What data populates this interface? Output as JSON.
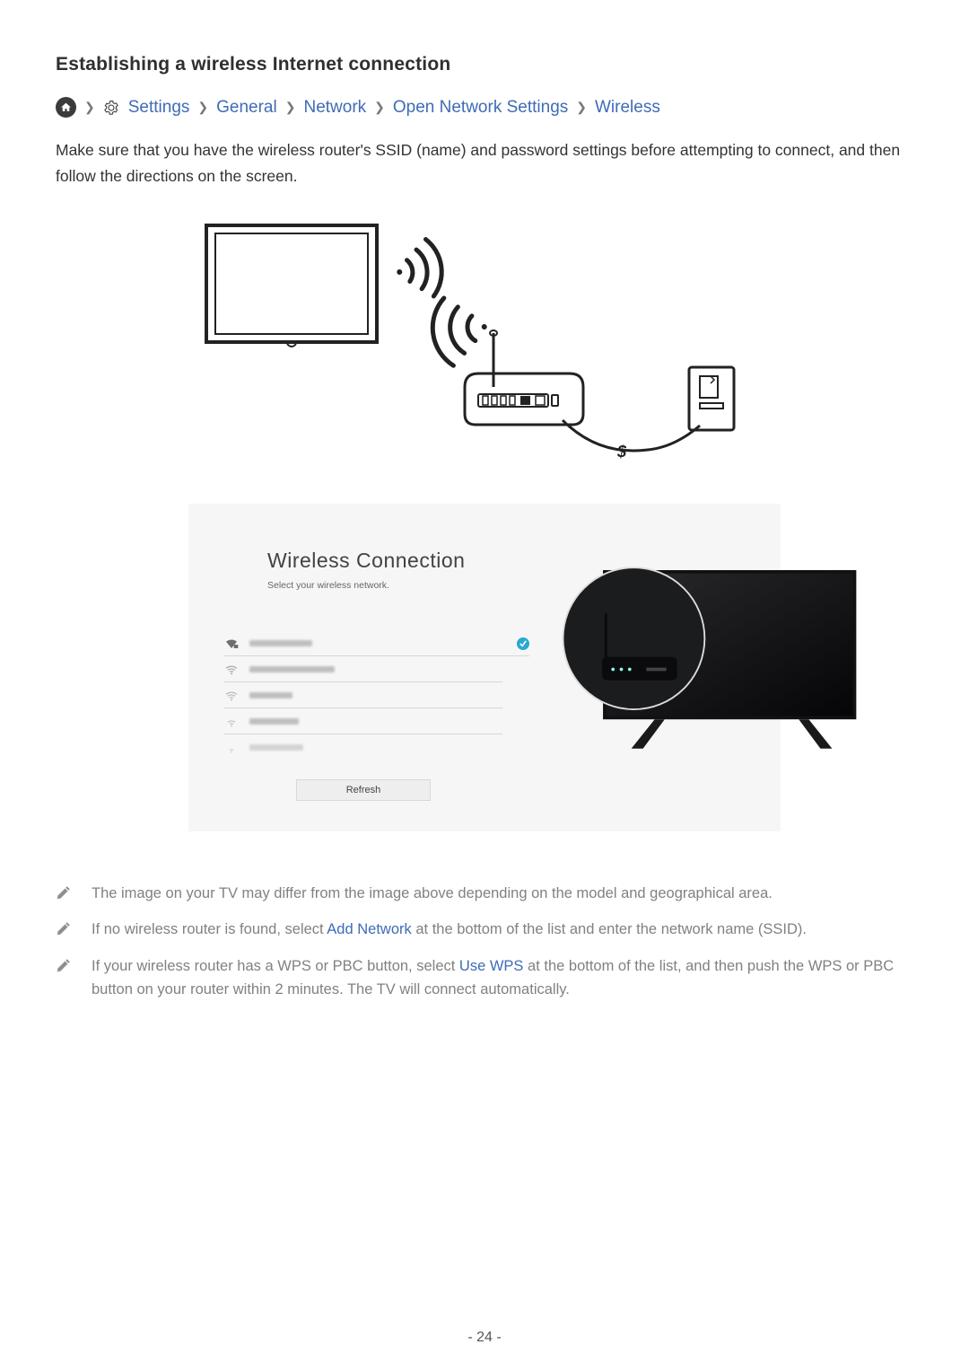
{
  "heading": "Establishing a wireless Internet connection",
  "breadcrumb": {
    "settings": "Settings",
    "general": "General",
    "network": "Network",
    "open_net": "Open Network Settings",
    "wireless": "Wireless"
  },
  "intro": "Make sure that you have the wireless router's SSID (name) and password settings before attempting to connect, and then follow the directions on the screen.",
  "ui": {
    "title": "Wireless Connection",
    "subtitle": "Select your wireless network.",
    "refresh": "Refresh"
  },
  "notes": {
    "n1": "The image on your TV may differ from the image above depending on the model and geographical area.",
    "n2a": "If no wireless router is found, select ",
    "n2link": "Add Network",
    "n2b": " at the bottom of the list and enter the network name (SSID).",
    "n3a": "If your wireless router has a WPS or PBC button, select ",
    "n3link": "Use WPS",
    "n3b": " at the bottom of the list, and then push the WPS or PBC button on your router within 2 minutes. The TV will connect automatically."
  },
  "pagenum": "- 24 -"
}
